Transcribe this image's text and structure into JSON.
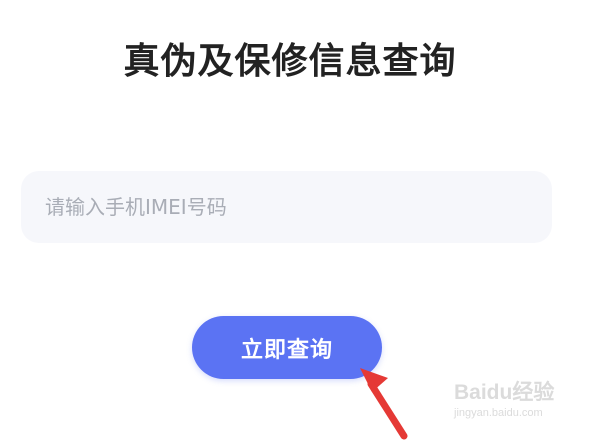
{
  "title": "真伪及保修信息查询",
  "imei_input": {
    "placeholder": "请输入手机IMEI号码",
    "value": ""
  },
  "query_button": {
    "label": "立即查询"
  },
  "watermark": {
    "brand": "Baidu经验",
    "domain": "jingyan.baidu.com"
  },
  "colors": {
    "accent": "#5b73f3",
    "arrow": "#e53935",
    "input_background": "#f6f7fb"
  }
}
